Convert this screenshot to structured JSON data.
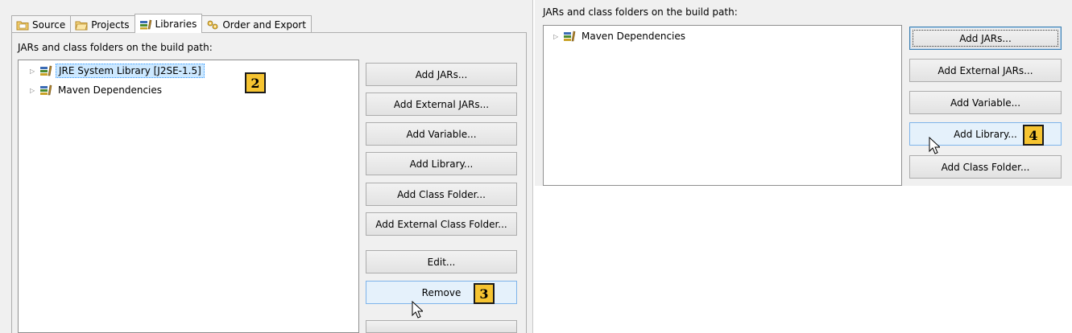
{
  "left": {
    "tabs": [
      {
        "label": "Source",
        "icon": "source-folder-icon",
        "active": false
      },
      {
        "label": "Projects",
        "icon": "projects-folder-icon",
        "active": false
      },
      {
        "label": "Libraries",
        "icon": "libraries-icon",
        "active": true
      },
      {
        "label": "Order and Export",
        "icon": "order-export-icon",
        "active": false
      }
    ],
    "heading": "JARs and class folders on the build path:",
    "tree": [
      {
        "label": "JRE System Library [J2SE-1.5]",
        "selected": true
      },
      {
        "label": "Maven Dependencies",
        "selected": false
      }
    ],
    "buttons": {
      "add_jars": "Add JARs...",
      "add_external_jars": "Add External JARs...",
      "add_variable": "Add Variable...",
      "add_library": "Add Library...",
      "add_class_folder": "Add Class Folder...",
      "add_external_class_folder": "Add External Class Folder...",
      "edit": "Edit...",
      "remove": "Remove"
    },
    "callouts": {
      "jre": "2",
      "remove": "3"
    }
  },
  "right": {
    "heading": "JARs and class folders on the build path:",
    "tree": [
      {
        "label": "Maven Dependencies",
        "selected": false
      }
    ],
    "buttons": {
      "add_jars": "Add JARs...",
      "add_external_jars": "Add External JARs...",
      "add_variable": "Add Variable...",
      "add_library": "Add Library...",
      "add_class_folder": "Add Class Folder..."
    },
    "callouts": {
      "add_library": "4"
    }
  },
  "colors": {
    "callout": "#f6c431",
    "selection": "#cce8ff",
    "hover_button": "#e5f1fb"
  }
}
